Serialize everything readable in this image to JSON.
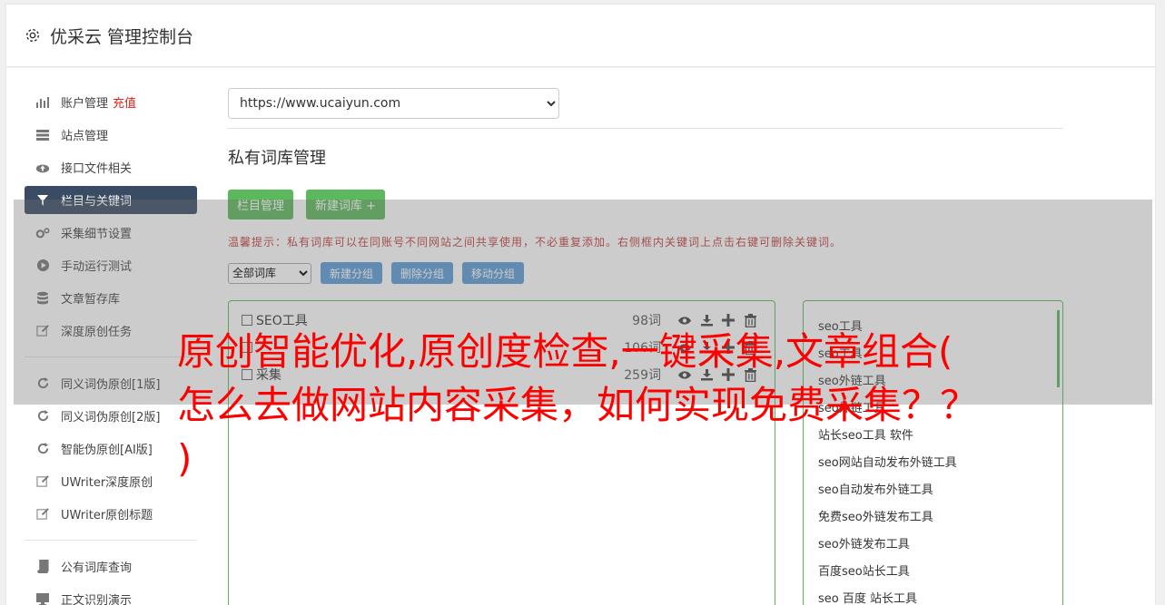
{
  "header": {
    "title": "优采云 管理控制台"
  },
  "sidebar": {
    "group1": [
      {
        "label": "账户管理",
        "badge": "充值",
        "icon": "bar-chart-icon"
      },
      {
        "label": "站点管理",
        "icon": "server-icon"
      },
      {
        "label": "接口文件相关",
        "icon": "cloud-upload-icon"
      },
      {
        "label": "栏目与关键词",
        "icon": "filter-icon",
        "active": true
      },
      {
        "label": "采集细节设置",
        "icon": "gears-icon"
      },
      {
        "label": "手动运行测试",
        "icon": "play-circle-icon"
      },
      {
        "label": "文章暂存库",
        "icon": "database-icon"
      },
      {
        "label": "深度原创任务",
        "icon": "edit-icon"
      }
    ],
    "group2": [
      {
        "label": "同义词伪原创[1版]",
        "icon": "refresh-icon"
      },
      {
        "label": "同义词伪原创[2版]",
        "icon": "refresh-icon"
      },
      {
        "label": "智能伪原创[AI版]",
        "icon": "refresh-icon"
      },
      {
        "label": "UWriter深度原创",
        "icon": "edit-icon"
      },
      {
        "label": "UWriter原创标题",
        "icon": "edit-icon"
      }
    ],
    "group3": [
      {
        "label": "公有词库查询",
        "icon": "book-icon"
      },
      {
        "label": "正文识别演示",
        "icon": "monitor-icon"
      }
    ]
  },
  "main": {
    "site_select": "https://www.ucaiyun.com",
    "section_title": "私有词库管理",
    "btn_column": "栏目管理",
    "btn_new_lib": "新建词库 +",
    "tip": "温馨提示：私有词库可以在同账号不同网站之间共享使用，不必重复添加。右侧框内关键词上点击右键可删除关键词。",
    "filter_select": "全部词库",
    "btn_new_group": "新建分组",
    "btn_del_group": "删除分组",
    "btn_move_group": "移动分组",
    "libraries": [
      {
        "name": "SEO工具",
        "count": "98词"
      },
      {
        "name": "",
        "count": "106词"
      },
      {
        "name": "采集",
        "count": "259词"
      }
    ],
    "keywords": [
      "seo工具",
      "seo工具",
      "seo外链工具",
      "seo外链工具",
      "站长seo工具 软件",
      "seo网站自动发布外链工具",
      "seo自动发布外链工具",
      "免费seo外链发布工具",
      "seo外链发布工具",
      "百度seo站长工具",
      "seo 百度 站长工具"
    ]
  },
  "overlay": {
    "line1": "原创智能优化,原创度检查,一键采集,文章组合(",
    "line2": "怎么去做网站内容采集，如何实现免费采集？？",
    "line3": ")"
  },
  "colors": {
    "accent_green": "#5cb85c",
    "accent_blue": "#5b9bd5",
    "active_nav": "#3a4c63",
    "overlay_red": "#ff0000"
  }
}
